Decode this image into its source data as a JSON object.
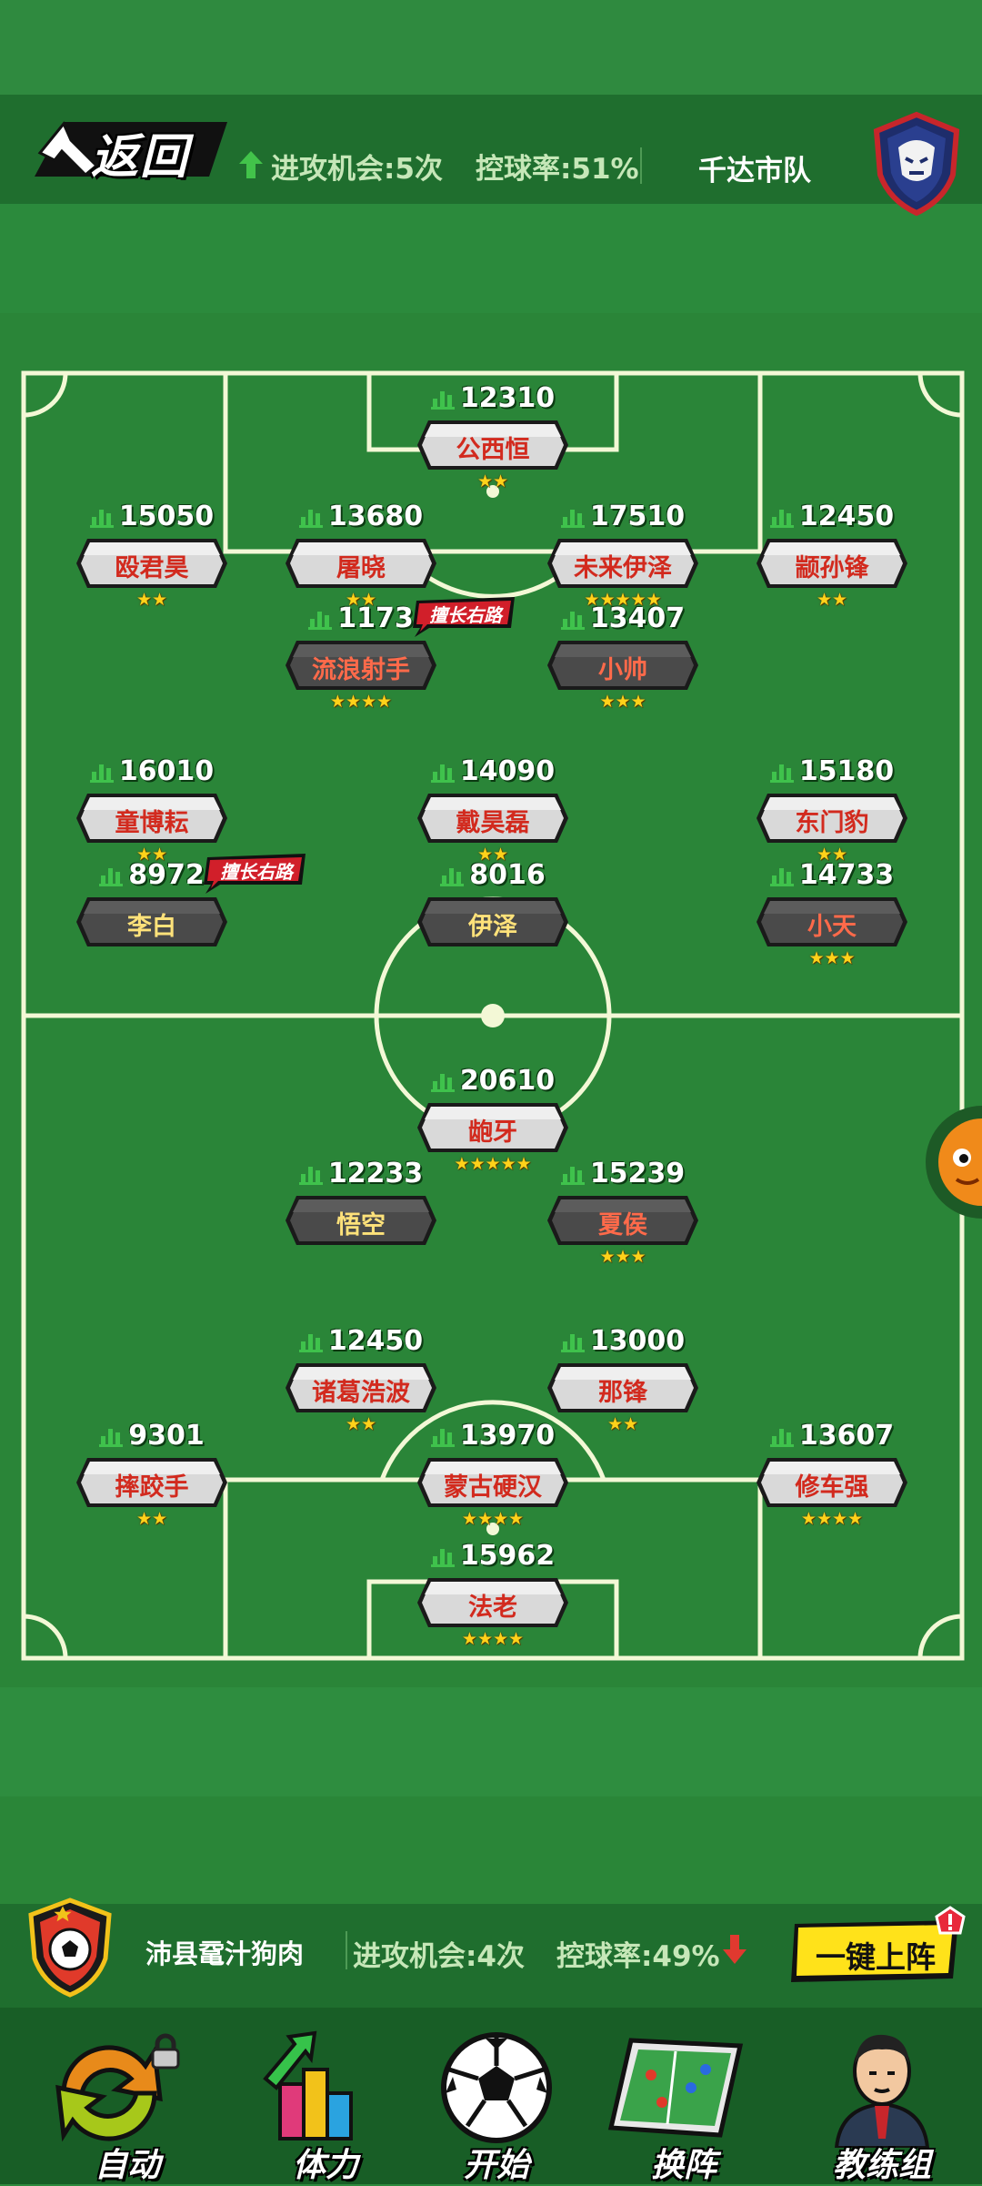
{
  "header": {
    "back_label": "返回",
    "attack_label": "进攻机会:5次",
    "possession_label": "控球率:51%",
    "team_name": "千达市队"
  },
  "tag_label": "擅长右路",
  "players": [
    {
      "hp": "12310",
      "name": "公西恒",
      "stars": 2,
      "plate": "light"
    },
    {
      "hp": "15050",
      "name": "殴君昊",
      "stars": 2,
      "plate": "light"
    },
    {
      "hp": "13680",
      "name": "屠晓",
      "stars": 2,
      "plate": "light"
    },
    {
      "hp": "17510",
      "name": "未来伊泽",
      "stars": 5,
      "plate": "light"
    },
    {
      "hp": "12450",
      "name": "颛孙锋",
      "stars": 2,
      "plate": "light"
    },
    {
      "hp": "1173",
      "name": "流浪射手",
      "stars": 4,
      "plate": "dark",
      "tag": true
    },
    {
      "hp": "13407",
      "name": "小帅",
      "stars": 3,
      "plate": "dark"
    },
    {
      "hp": "16010",
      "name": "童博耘",
      "stars": 2,
      "plate": "light"
    },
    {
      "hp": "14090",
      "name": "戴昊磊",
      "stars": 2,
      "plate": "light"
    },
    {
      "hp": "15180",
      "name": "东门豹",
      "stars": 2,
      "plate": "light"
    },
    {
      "hp": "8972",
      "name": "李白",
      "stars": 0,
      "plate": "dark",
      "tag": true
    },
    {
      "hp": "8016",
      "name": "伊泽",
      "stars": 0,
      "plate": "dark"
    },
    {
      "hp": "14733",
      "name": "小天",
      "stars": 3,
      "plate": "dark"
    },
    {
      "hp": "20610",
      "name": "龅牙",
      "stars": 5,
      "plate": "light"
    },
    {
      "hp": "12233",
      "name": "悟空",
      "stars": 0,
      "plate": "dark"
    },
    {
      "hp": "15239",
      "name": "夏侯",
      "stars": 3,
      "plate": "dark"
    },
    {
      "hp": "12450",
      "name": "诸葛浩波",
      "stars": 2,
      "plate": "light"
    },
    {
      "hp": "13000",
      "name": "那锋",
      "stars": 2,
      "plate": "light"
    },
    {
      "hp": "9301",
      "name": "摔跤手",
      "stars": 2,
      "plate": "light"
    },
    {
      "hp": "13970",
      "name": "蒙古硬汉",
      "stars": 4,
      "plate": "light"
    },
    {
      "hp": "13607",
      "name": "修车强",
      "stars": 4,
      "plate": "light"
    },
    {
      "hp": "15962",
      "name": "法老",
      "stars": 4,
      "plate": "light"
    }
  ],
  "footer": {
    "team_name": "沛县鼋汁狗肉",
    "attack_label": "进攻机会:4次",
    "possession_label": "控球率:49%",
    "auto_lineup_label": "一键上阵"
  },
  "dock": [
    {
      "label": "自动",
      "icon": "auto-rotate-icon",
      "locked": true
    },
    {
      "label": "体力",
      "icon": "stamina-chart-icon"
    },
    {
      "label": "开始",
      "icon": "soccer-ball-icon"
    },
    {
      "label": "换阵",
      "icon": "tactics-board-icon"
    },
    {
      "label": "教练组",
      "icon": "coach-icon"
    }
  ],
  "colors": {
    "plate_light": "#d9d9d9",
    "plate_dark": "#4a4a4a",
    "name_red": "#d22a1e",
    "name_gold": "#ffd21a",
    "hp_icon": "#3fc24c",
    "tag_red": "#d11f2a",
    "up_arrow": "#42c34a",
    "down_arrow": "#e0392f"
  }
}
